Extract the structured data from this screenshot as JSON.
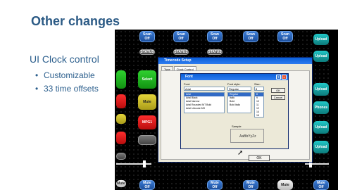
{
  "slide": {
    "title": "Other changes",
    "subtitle": "UI Clock control",
    "bullets": [
      "Customizable",
      "33 time offsets"
    ],
    "bullet_glyph": "•"
  },
  "panel": {
    "top_buttons": [
      "Scan Off",
      "Scan Off",
      "Scan Off",
      "Scan Off",
      "Scan Off"
    ],
    "row2": [
      "STATUS",
      "STATUS",
      "STATUS"
    ],
    "left_buttons": [
      "Select",
      "Mute",
      "MPG1"
    ],
    "bottom_buttons": [
      "Mute",
      "Mute Off",
      "Mute Off",
      "Mute Off",
      "Mute",
      "Mute Off"
    ],
    "right_buttons": [
      "Upload",
      "Upload",
      "Upload",
      "Phones",
      "Upload",
      "Upload"
    ]
  },
  "setup_dialog": {
    "title": "Timecode Setup",
    "tabs": [
      "Type",
      "Clock Control"
    ],
    "ok": "OK"
  },
  "font_dialog": {
    "title": "Font",
    "font_label": "Font:",
    "style_label": "Font style:",
    "size_label": "Size:",
    "font_value": "Arial",
    "style_value": "Regular",
    "size_value": "8",
    "fonts": [
      "Arial",
      "Arial Black",
      "Arial Narrow",
      "Arial Rounded MT Bold",
      "Arial Unicode MS"
    ],
    "styles": [
      "Regular",
      "Italic",
      "Bold",
      "Bold Italic"
    ],
    "sizes": [
      "8",
      "9",
      "10",
      "11",
      "12",
      "14",
      "16"
    ],
    "ok": "OK",
    "cancel": "Cancel",
    "sample_label": "Sample",
    "sample_text": "AaBbYyZz"
  },
  "colors": {
    "title": "#2b5a85",
    "accent_blue": "#1d4f9c",
    "titlebar": "#0a5fd8"
  }
}
